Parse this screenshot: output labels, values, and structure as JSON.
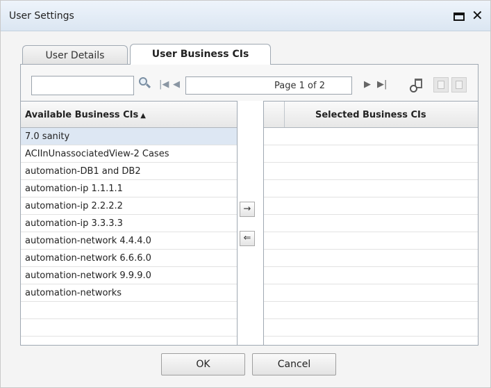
{
  "dialog": {
    "title": "User Settings",
    "icons": {
      "maximize": "maximize-icon",
      "close": "close-icon"
    }
  },
  "tabs": [
    {
      "label": "User Details",
      "active": false
    },
    {
      "label": "User Business CIs",
      "active": true
    }
  ],
  "toolbar": {
    "search_value": "",
    "page_text": "Page 1 of 2",
    "icons": [
      "search-icon",
      "first-page-icon",
      "prev-page-icon",
      "next-page-icon",
      "last-page-icon",
      "clear-history-icon",
      "export-icon",
      "export-icon"
    ]
  },
  "available": {
    "header": "Available Business CIs",
    "sort": "ascending",
    "items": [
      {
        "label": "7.0 sanity",
        "selected": true
      },
      {
        "label": "ACIInUnassociatedView-2 Cases",
        "selected": false
      },
      {
        "label": "automation-DB1 and DB2",
        "selected": false
      },
      {
        "label": "automation-ip 1.1.1.1",
        "selected": false
      },
      {
        "label": "automation-ip 2.2.2.2",
        "selected": false
      },
      {
        "label": "automation-ip 3.3.3.3",
        "selected": false
      },
      {
        "label": "automation-network 4.4.4.0",
        "selected": false
      },
      {
        "label": "automation-network 6.6.6.0",
        "selected": false
      },
      {
        "label": "automation-network 9.9.9.0",
        "selected": false
      },
      {
        "label": "automation-networks",
        "selected": false
      }
    ]
  },
  "selected": {
    "header": "Selected Business CIs",
    "items": []
  },
  "buttons": {
    "add_label": "→",
    "remove_label": "⇐",
    "ok": "OK",
    "cancel": "Cancel"
  }
}
